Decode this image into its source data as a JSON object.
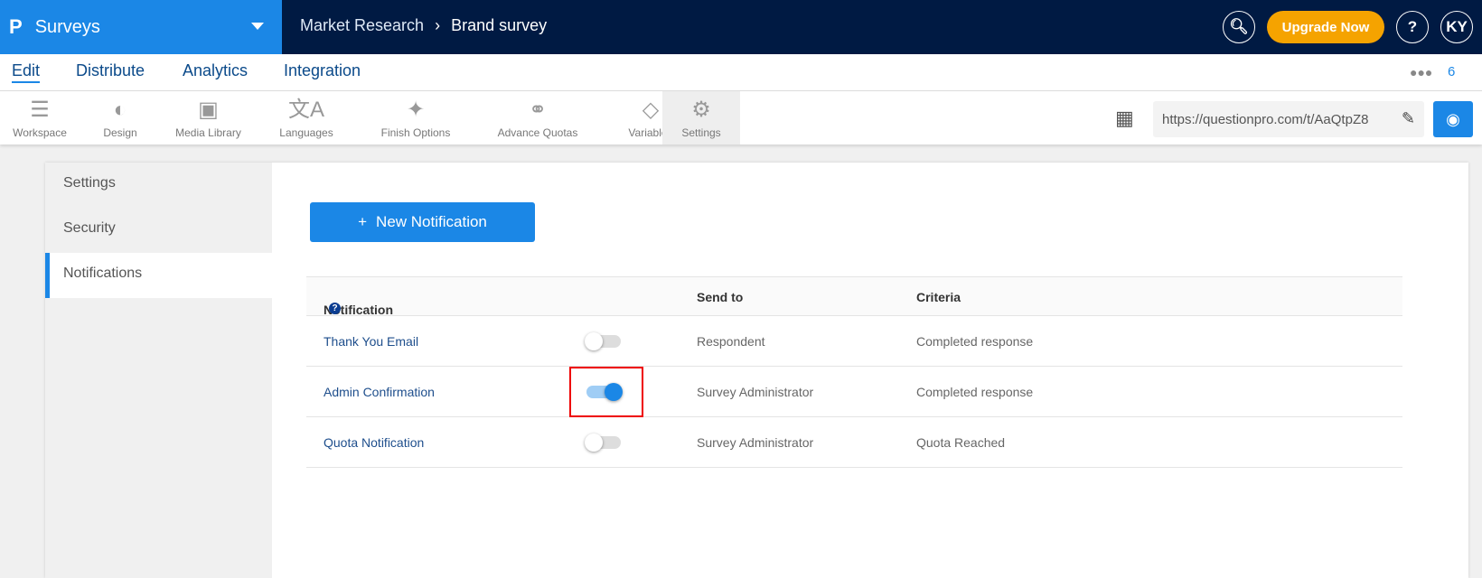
{
  "app": {
    "name": "Surveys",
    "logo": "P"
  },
  "breadcrumb": [
    "Market Research",
    "Brand survey"
  ],
  "header": {
    "upgrade_label": "Upgrade Now",
    "help": "?",
    "avatar": "KY"
  },
  "nav": {
    "tabs": [
      "Edit",
      "Distribute",
      "Analytics",
      "Integration"
    ],
    "active": "Edit",
    "collaborators": "6"
  },
  "toolbar": {
    "items": [
      {
        "label": "Workspace",
        "icon": "workspace-icon"
      },
      {
        "label": "Design",
        "icon": "palette-icon"
      },
      {
        "label": "Media Library",
        "icon": "image-icon"
      },
      {
        "label": "Languages",
        "icon": "translate-icon"
      },
      {
        "label": "Finish Options",
        "icon": "magic-wand-icon"
      },
      {
        "label": "Advance Quotas",
        "icon": "link-icon"
      },
      {
        "label": "Variables",
        "icon": "tag-icon"
      },
      {
        "label": "Settings",
        "icon": "gear-icon"
      }
    ],
    "active": "Settings",
    "url": "https://questionpro.com/t/AaQtpZ8"
  },
  "sidebar": {
    "items": [
      "Settings",
      "Security",
      "Notifications"
    ],
    "active": "Notifications"
  },
  "main": {
    "new_button": "New Notification",
    "columns": [
      "Notification",
      "Send to",
      "Criteria"
    ],
    "rows": [
      {
        "name": "Thank You Email",
        "enabled": false,
        "send_to": "Respondent",
        "criteria": "Completed response"
      },
      {
        "name": "Admin Confirmation",
        "enabled": true,
        "send_to": "Survey Administrator",
        "criteria": "Completed response"
      },
      {
        "name": "Quota Notification",
        "enabled": false,
        "send_to": "Survey Administrator",
        "criteria": "Quota Reached"
      }
    ]
  }
}
